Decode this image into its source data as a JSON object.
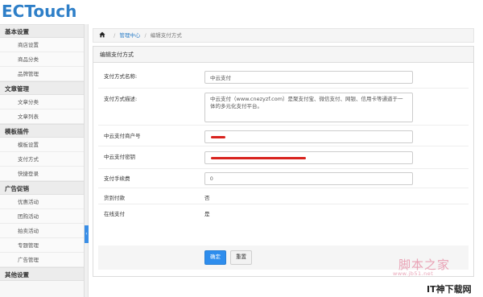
{
  "app": {
    "logo": "ECTouch"
  },
  "sidebar": {
    "groups": [
      {
        "title": "基本设置",
        "items": [
          "商店设置",
          "商品分类",
          "品牌管理"
        ]
      },
      {
        "title": "文章管理",
        "items": [
          "文章分类",
          "文章列表"
        ]
      },
      {
        "title": "模板插件",
        "items": [
          "模板设置",
          "支付方式",
          "快捷登录"
        ]
      },
      {
        "title": "广告促销",
        "items": [
          "优惠活动",
          "团购活动",
          "拍卖活动",
          "专题管理",
          "广告管理"
        ]
      },
      {
        "title": "其他设置",
        "items": []
      }
    ]
  },
  "breadcrumb": {
    "link": "管理中心",
    "current": "编辑支付方式"
  },
  "panel": {
    "title": "编辑支付方式"
  },
  "form": {
    "name_label": "支付方式名称:",
    "name_value": "中云支付",
    "desc_label": "支付方式描述:",
    "desc_value": "中云支付（www.cnezyzf.com）是聚支付宝、微信支付、网银、信用卡等通道于一体的多元化支付平台。",
    "merchant_label": "中云支付商户号",
    "key_label": "中云支付密钥",
    "fee_label": "支付手续费",
    "fee_value": "0",
    "cod_label": "货到付款",
    "cod_value": "否",
    "online_label": "在线支付",
    "online_value": "是",
    "submit_label": "确定",
    "reset_label": "重置"
  },
  "watermarks": {
    "site_name": "脚本之家",
    "site_url": "www.jb51.net",
    "download_mark": "IT神下载网"
  },
  "colors": {
    "accent": "#2e8ded",
    "redaction": "#d8231e",
    "logo": "#2e7fc8"
  }
}
